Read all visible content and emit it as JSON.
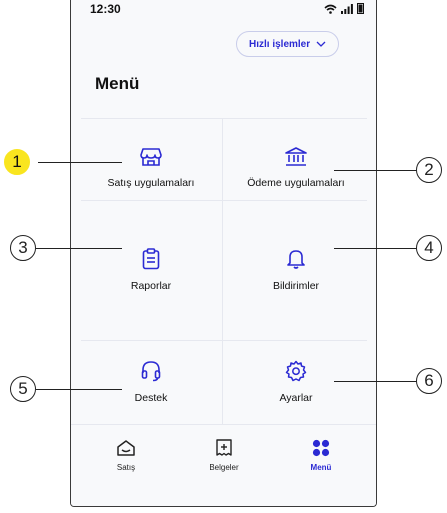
{
  "status_bar": {
    "time": "12:30"
  },
  "header": {
    "quick_actions_label": "Hızlı işlemler",
    "title": "Menü"
  },
  "tiles": [
    {
      "label": "Satış uygulamaları",
      "icon": "store-icon"
    },
    {
      "label": "Ödeme uygulamaları",
      "icon": "bank-icon"
    },
    {
      "label": "Raporlar",
      "icon": "clipboard-icon"
    },
    {
      "label": "Bildirimler",
      "icon": "bell-icon"
    },
    {
      "label": "Destek",
      "icon": "headset-icon"
    },
    {
      "label": "Ayarlar",
      "icon": "gear-icon"
    }
  ],
  "bottom_nav": {
    "items": [
      {
        "label": "Satış",
        "icon": "home-icon",
        "active": false
      },
      {
        "label": "Belgeler",
        "icon": "receipt-icon",
        "active": false
      },
      {
        "label": "Menü",
        "icon": "grid-icon",
        "active": true
      }
    ]
  },
  "callouts": [
    "1",
    "2",
    "3",
    "4",
    "5",
    "6"
  ],
  "colors": {
    "accent": "#2b2ad3",
    "highlight": "#f9e51f",
    "divider": "#e6e8ef"
  }
}
